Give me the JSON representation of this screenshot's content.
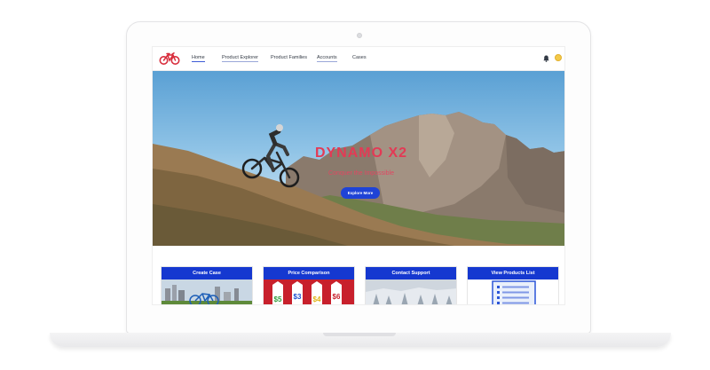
{
  "nav": {
    "items": [
      {
        "label": "Home"
      },
      {
        "label": "Product Explorer"
      },
      {
        "label": "Product Families"
      },
      {
        "label": "Accounts"
      },
      {
        "label": "Cases"
      }
    ]
  },
  "hero": {
    "title": "DYNAMO X2",
    "subtitle": "Conquer the Impossible",
    "button_label": "Explore More"
  },
  "tiles": [
    {
      "label": "Create Case"
    },
    {
      "label": "Price Comparison",
      "price_tags": [
        "$5",
        "$3",
        "$4",
        "$6"
      ]
    },
    {
      "label": "Contact Support"
    },
    {
      "label": "View Products List"
    }
  ],
  "colors": {
    "brand_blue": "#1538d0",
    "accent_red": "#e33a55",
    "logo_red": "#d82d3c"
  },
  "icons": [
    "bicycle-logo-icon",
    "bell-icon",
    "user-avatar"
  ]
}
